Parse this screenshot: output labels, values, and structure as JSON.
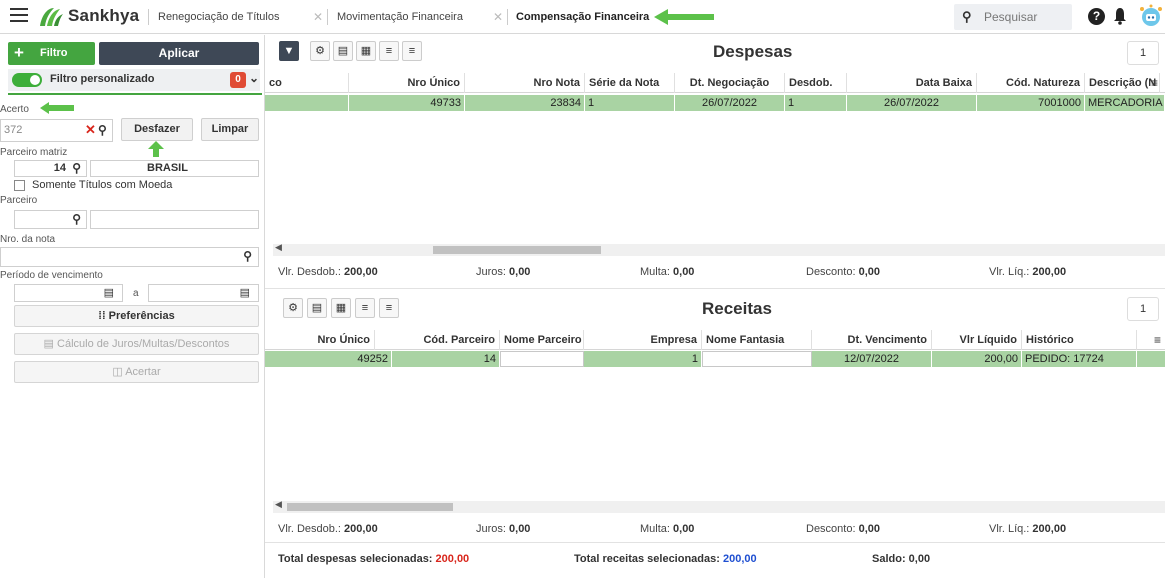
{
  "topbar": {
    "logo_text": "Sankhya",
    "tabs": [
      {
        "label": "Renegociação de Títulos"
      },
      {
        "label": "Movimentação Financeira"
      },
      {
        "label": "Compensação Financeira"
      }
    ],
    "search_placeholder": "Pesquisar"
  },
  "left": {
    "filtro_label": "Filtro",
    "aplicar_label": "Aplicar",
    "filtro_personalizado": "Filtro personalizado",
    "badge_count": "0",
    "acerto_label": "Acerto",
    "acerto_value": "372",
    "desfazer_label": "Desfazer",
    "limpar_label": "Limpar",
    "parceiro_matriz_label": "Parceiro matriz",
    "parceiro_matriz_code": "14",
    "parceiro_matriz_name": "BRASIL",
    "somente_moeda_label": "Somente Títulos com Moeda",
    "parceiro_label": "Parceiro",
    "nro_nota_label": "Nro. da nota",
    "periodo_label": "Período de vencimento",
    "periodo_sep": "a",
    "preferencias_label": "Preferências",
    "calculo_label": "Cálculo de Juros/Multas/Descontos",
    "acertar_label": "Acertar"
  },
  "despesas": {
    "title": "Despesas",
    "page": "1",
    "columns": [
      "co",
      "Nro Único",
      "Nro Nota",
      "Série da Nota",
      "Dt. Negociação",
      "Desdob.",
      "Data Baixa",
      "Cód. Natureza",
      "Descrição (N"
    ],
    "row": [
      "",
      "49733",
      "23834",
      "1",
      "26/07/2022",
      "1",
      "26/07/2022",
      "7001000",
      "MERCADORIA"
    ],
    "totals": {
      "vlr_desdob": "Vlr. Desdob.: ",
      "vlr_desdob_val": "200,00",
      "juros": "Juros: ",
      "juros_val": "0,00",
      "multa": "Multa: ",
      "multa_val": "0,00",
      "desconto": "Desconto: ",
      "desconto_val": "0,00",
      "vlr_liq": "Vlr. Líq.: ",
      "vlr_liq_val": "200,00"
    }
  },
  "receitas": {
    "title": "Receitas",
    "page": "1",
    "columns": [
      "Nro Único",
      "Cód. Parceiro",
      "Nome Parceiro",
      "Empresa",
      "Nome Fantasia",
      "Dt. Vencimento",
      "Vlr Líquido",
      "Histórico"
    ],
    "row": [
      "49252",
      "14",
      "",
      "1",
      "",
      "12/07/2022",
      "200,00",
      "PEDIDO: 17724"
    ],
    "totals": {
      "vlr_desdob": "Vlr. Desdob.: ",
      "vlr_desdob_val": "200,00",
      "juros": "Juros: ",
      "juros_val": "0,00",
      "multa": "Multa: ",
      "multa_val": "0,00",
      "desconto": "Desconto: ",
      "desconto_val": "0,00",
      "vlr_liq": "Vlr. Líq.: ",
      "vlr_liq_val": "200,00"
    }
  },
  "footer": {
    "total_despesas_label": "Total despesas selecionadas: ",
    "total_despesas_val": "200,00",
    "total_receitas_label": "Total receitas selecionadas: ",
    "total_receitas_val": "200,00",
    "saldo_label": "Saldo: ",
    "saldo_val": "0,00"
  },
  "colors": {
    "accent_green": "#44a540",
    "row_green": "#a9d3a3",
    "dark_button": "#3e4856",
    "badge_red": "#e04b35",
    "total_red": "#d9261c",
    "total_blue": "#1f4fd1"
  }
}
